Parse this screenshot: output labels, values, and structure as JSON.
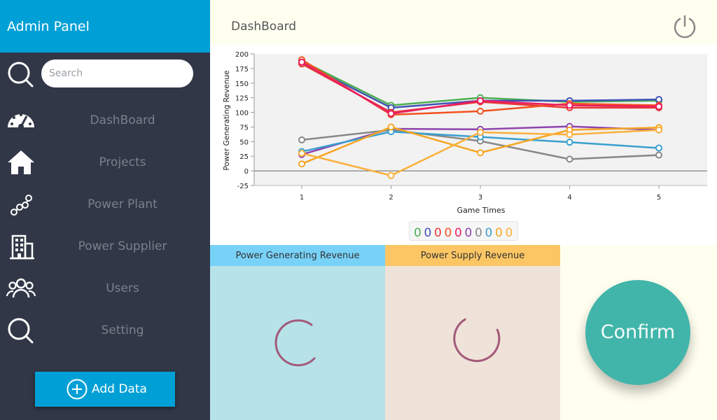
{
  "app": {
    "title": "Admin Panel"
  },
  "search": {
    "placeholder": "Search"
  },
  "nav": [
    {
      "label": "DashBoard",
      "icon": "dashboard-gauge-icon"
    },
    {
      "label": "Projects",
      "icon": "home-icon"
    },
    {
      "label": "Power Plant",
      "icon": "network-nodes-icon"
    },
    {
      "label": "Power Supplier",
      "icon": "building-icon"
    },
    {
      "label": "Users",
      "icon": "users-group-icon"
    },
    {
      "label": "Setting",
      "icon": "search-icon"
    }
  ],
  "add_button": {
    "label": "Add Data",
    "icon": "plus-circle-icon"
  },
  "header": {
    "title": "DashBoard",
    "icon": "power-icon"
  },
  "chart_data": {
    "type": "line",
    "xlabel": "Game Times",
    "ylabel": "Power Generating Revenue",
    "x": [
      1,
      2,
      3,
      4,
      5
    ],
    "ylim": [
      -25,
      200
    ],
    "yticks": [
      -25,
      0,
      25,
      50,
      75,
      100,
      125,
      150,
      175,
      200
    ],
    "grid": false,
    "series": [
      {
        "color": "#4caf50",
        "values": [
          188,
          112,
          125,
          118,
          120
        ]
      },
      {
        "color": "#3f51b5",
        "values": [
          185,
          108,
          120,
          120,
          122
        ]
      },
      {
        "color": "#e53935",
        "values": [
          183,
          100,
          118,
          108,
          108
        ]
      },
      {
        "color": "#f4511e",
        "values": [
          190,
          96,
          102,
          115,
          112
        ]
      },
      {
        "color": "#e91e63",
        "values": [
          186,
          98,
          120,
          112,
          110
        ]
      },
      {
        "color": "#8e44ad",
        "values": [
          28,
          72,
          71,
          76,
          70
        ]
      },
      {
        "color": "#888888",
        "values": [
          53,
          70,
          51,
          20,
          27
        ]
      },
      {
        "color": "#39a0cf",
        "values": [
          33,
          67,
          58,
          49,
          39
        ]
      },
      {
        "color": "#f5a623",
        "values": [
          12,
          75,
          31,
          70,
          74
        ]
      },
      {
        "color": "#fbb03b",
        "values": [
          30,
          -8,
          66,
          62,
          70
        ]
      }
    ],
    "legend_text": "0000000000"
  },
  "panels": {
    "generating": {
      "title": "Power Generating Revenue",
      "color": "#78d2f8"
    },
    "supply": {
      "title": "Power Supply Revenue",
      "color": "#fcc664"
    }
  },
  "confirm": {
    "label": "Confirm"
  }
}
